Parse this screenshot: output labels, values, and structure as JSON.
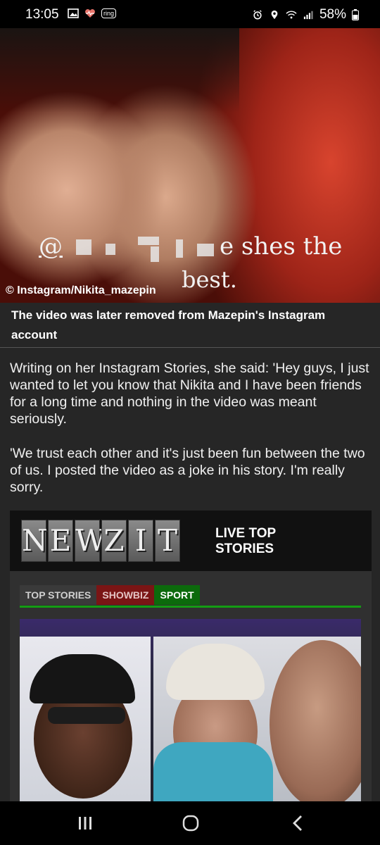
{
  "status_bar": {
    "time": "13:05",
    "left_icons": [
      "gallery-icon",
      "heart-monitor-icon",
      "ring-icon"
    ],
    "ring_label": "ring",
    "right_icons": [
      "alarm-icon",
      "location-icon",
      "wifi-icon",
      "signal-icon",
      "battery-icon"
    ],
    "battery": "58%"
  },
  "hero": {
    "overlay_text_1": "@",
    "overlay_text_1b": "e  shes the",
    "overlay_text_2": "best.",
    "credit": "© Instagram/Nikita_mazepin"
  },
  "caption": "The video was later removed from Mazepin's Instagram account",
  "article": {
    "paragraphs": [
      "Writing on her Instagram Stories, she said: 'Hey guys, I just wanted to let you know that Nikita and I have been friends for a long time and nothing in the video was meant seriously.",
      "'We trust each other and it's just been fun between the two of us. I posted the video as a joke in his story. I'm really sorry."
    ]
  },
  "newzit": {
    "logo_letters": [
      "N",
      "E",
      "W",
      "Z",
      "I",
      "T"
    ],
    "live_label": "LIVE TOP STORIES",
    "tabs": [
      {
        "label": "TOP STORIES",
        "color": "#3a3a3a"
      },
      {
        "label": "SHOWBIZ",
        "color": "#7a1515"
      },
      {
        "label": "SPORT",
        "color": "#0c6a0c"
      }
    ],
    "active_tab": "SPORT"
  },
  "nav": {
    "recent_icon": "recent-apps-icon",
    "home_icon": "home-icon",
    "back_icon": "back-icon"
  }
}
